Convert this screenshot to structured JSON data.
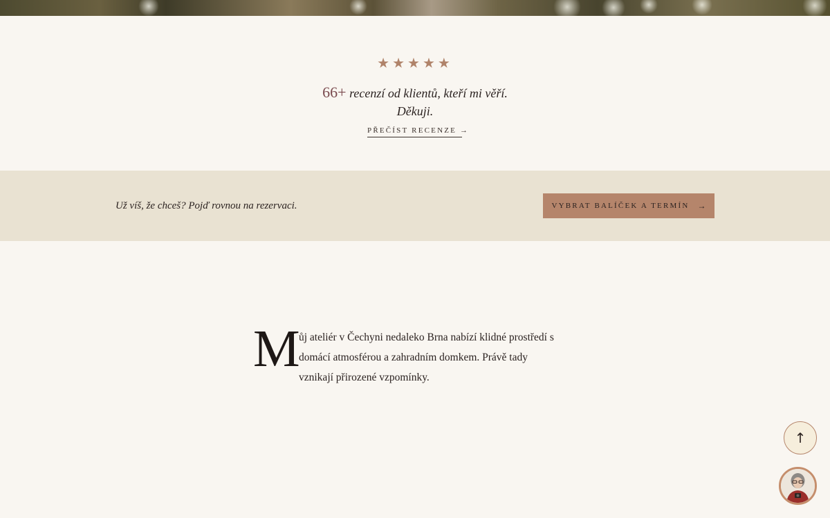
{
  "reviews": {
    "rating_stars": 5,
    "stars_text": "★★★★★",
    "count": "66+",
    "line": " recenzí od klientů, kteří mi věří.",
    "thanks": "Děkuji.",
    "link_label": "PŘEČÍST RECENZE →"
  },
  "cta": {
    "text": "Už víš, že chceš? Pojď rovnou na rezervaci.",
    "button_label": "VYBRAT BALÍČEK A TERMÍN",
    "button_arrow": "→"
  },
  "intro": {
    "drop_cap": "M",
    "text": "ůj ateliér v Čechyni nedaleko Brna nabízí klidné prostředí s domácí atmosférou a zahradním domkem. Právě tady vznikají přirozené vzpomínky."
  },
  "floating": {
    "scroll_top_icon": "↑"
  },
  "colors": {
    "background": "#f9f6f1",
    "band": "#e9e2d2",
    "accent": "#b5856b",
    "star": "#b0836a",
    "count": "#7a4a4e"
  },
  "icons": {
    "star": "star-icon",
    "scroll_top": "arrow-up-icon",
    "avatar": "avatar-photo"
  }
}
